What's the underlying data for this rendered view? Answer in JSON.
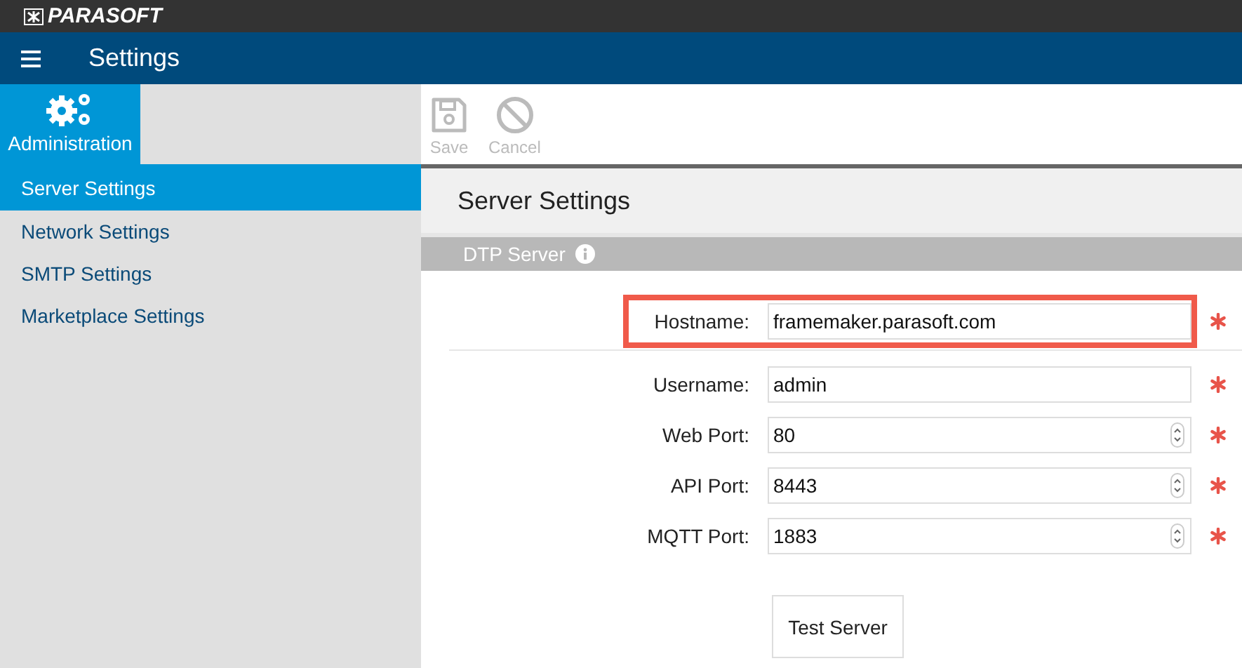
{
  "brand": {
    "logo": "PARASOFT"
  },
  "header": {
    "title": "Settings"
  },
  "sidebar": {
    "section": {
      "label": "Administration",
      "selected": true
    },
    "items": [
      {
        "label": "Server Settings",
        "selected": true
      },
      {
        "label": "Network Settings",
        "selected": false
      },
      {
        "label": "SMTP Settings",
        "selected": false
      },
      {
        "label": "Marketplace Settings",
        "selected": false
      }
    ]
  },
  "toolbar": [
    {
      "kind": "save",
      "label": "Save",
      "disabled": true
    },
    {
      "kind": "cancel",
      "label": "Cancel",
      "disabled": true
    }
  ],
  "page_title": "Server Settings",
  "section": {
    "title": "DTP Server"
  },
  "fields": [
    {
      "label": "Hostname:",
      "value": "framemaker.parasoft.com",
      "kind": "text",
      "required": true,
      "highlighted": true
    },
    {
      "label": "Username:",
      "value": "admin",
      "kind": "text",
      "required": true,
      "highlighted": false
    },
    {
      "label": "Web Port:",
      "value": "80",
      "kind": "number",
      "required": true,
      "highlighted": false
    },
    {
      "label": "API Port:",
      "value": "8443",
      "kind": "number",
      "required": true,
      "highlighted": false
    },
    {
      "label": "MQTT Port:",
      "value": "1883",
      "kind": "number",
      "required": true,
      "highlighted": false
    }
  ],
  "test_button": "Test Server"
}
